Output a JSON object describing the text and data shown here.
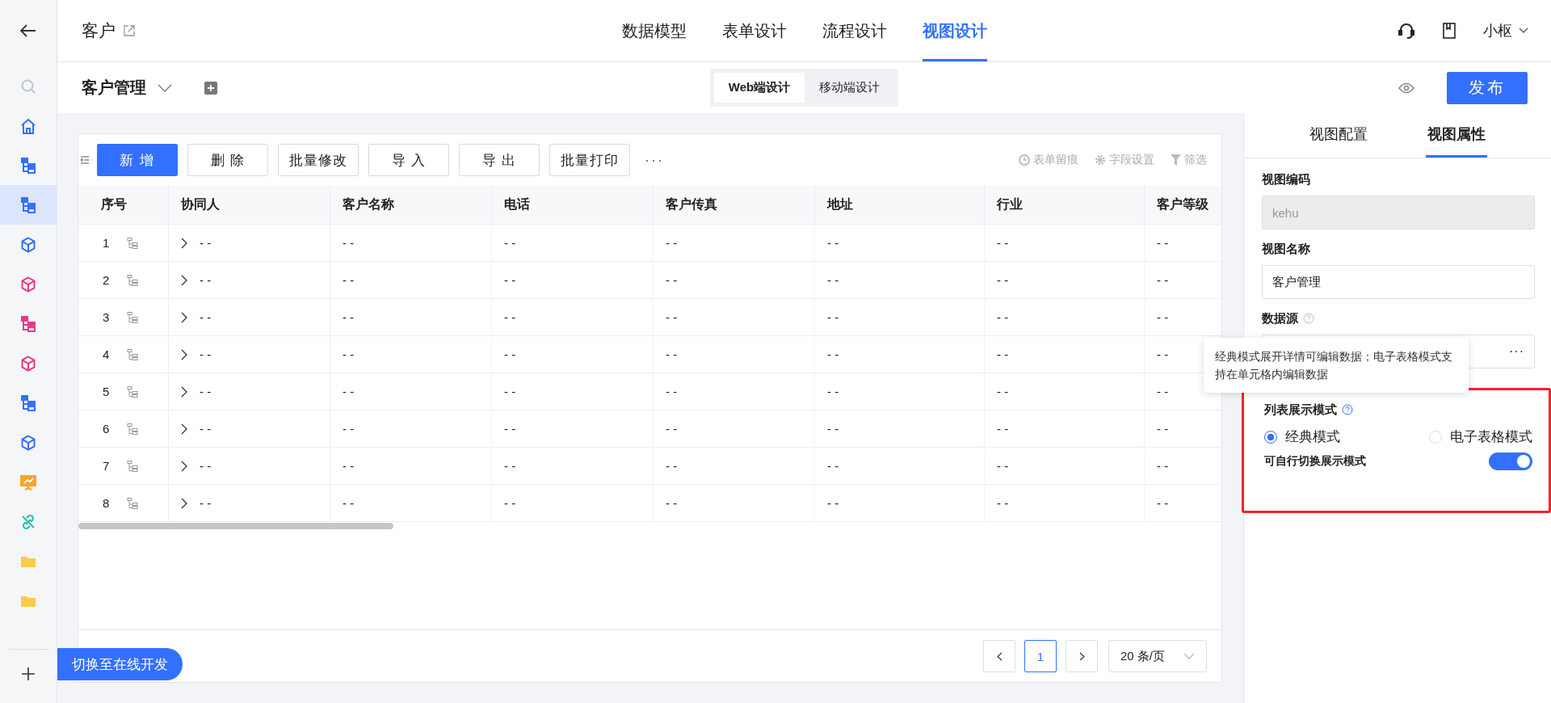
{
  "sidebar": {
    "items": [
      {
        "kind": "search",
        "color": "#c0c4cc",
        "selected": false
      },
      {
        "kind": "home",
        "color": "#3370ff",
        "selected": false
      },
      {
        "kind": "tree",
        "color": "#3370ff",
        "selected": false
      },
      {
        "kind": "tree",
        "color": "#3370ff",
        "selected": true
      },
      {
        "kind": "cube",
        "color": "#3370ff",
        "selected": false
      },
      {
        "kind": "cube",
        "color": "#e8388a",
        "selected": false
      },
      {
        "kind": "tree",
        "color": "#e8388a",
        "selected": false
      },
      {
        "kind": "cube",
        "color": "#e8388a",
        "selected": false
      },
      {
        "kind": "tree",
        "color": "#3370ff",
        "selected": false
      },
      {
        "kind": "cube",
        "color": "#3370ff",
        "selected": false
      },
      {
        "kind": "board",
        "color": "#f5a623",
        "selected": false
      },
      {
        "kind": "link",
        "color": "#2bbdb0",
        "selected": false
      },
      {
        "kind": "folder",
        "color": "#fdc94a",
        "selected": false
      },
      {
        "kind": "folder",
        "color": "#fdc94a",
        "selected": false
      }
    ]
  },
  "header": {
    "title": "客户",
    "nav": [
      {
        "label": "数据模型",
        "selected": false
      },
      {
        "label": "表单设计",
        "selected": false
      },
      {
        "label": "流程设计",
        "selected": false
      },
      {
        "label": "视图设计",
        "selected": true
      }
    ],
    "user": "小枢"
  },
  "subbar": {
    "view_name": "客户管理",
    "devices": [
      {
        "label": "Web端设计",
        "selected": true
      },
      {
        "label": "移动端设计",
        "selected": false
      }
    ],
    "publish": "发布"
  },
  "toolbar": {
    "buttons": [
      {
        "label": "新 增",
        "kind": "primary"
      },
      {
        "label": "删 除",
        "kind": "default"
      },
      {
        "label": "批量修改",
        "kind": "default"
      },
      {
        "label": "导 入",
        "kind": "default"
      },
      {
        "label": "导 出",
        "kind": "default"
      },
      {
        "label": "批量打印",
        "kind": "default"
      }
    ],
    "more": "···",
    "tools": [
      {
        "label": "表单留痕",
        "kind": "clock"
      },
      {
        "label": "字段设置",
        "kind": "gear"
      },
      {
        "label": "筛选",
        "kind": "filter"
      }
    ]
  },
  "table": {
    "columns": [
      "序号",
      "协同人",
      "客户名称",
      "电话",
      "客户传真",
      "地址",
      "行业",
      "客户等级"
    ],
    "rows": [
      {
        "cells": [
          "1",
          "- -",
          "- -",
          "- -",
          "- -",
          "- -",
          "- -",
          "- -"
        ]
      },
      {
        "cells": [
          "2",
          "- -",
          "- -",
          "- -",
          "- -",
          "- -",
          "- -",
          "- -"
        ]
      },
      {
        "cells": [
          "3",
          "- -",
          "- -",
          "- -",
          "- -",
          "- -",
          "- -",
          "- -"
        ]
      },
      {
        "cells": [
          "4",
          "- -",
          "- -",
          "- -",
          "- -",
          "- -",
          "- -",
          "- -"
        ]
      },
      {
        "cells": [
          "5",
          "- -",
          "- -",
          "- -",
          "- -",
          "- -",
          "- -",
          "- -"
        ]
      },
      {
        "cells": [
          "6",
          "- -",
          "- -",
          "- -",
          "- -",
          "- -",
          "- -",
          "- -"
        ]
      },
      {
        "cells": [
          "7",
          "- -",
          "- -",
          "- -",
          "- -",
          "- -",
          "- -",
          "- -"
        ]
      },
      {
        "cells": [
          "8",
          "- -",
          "- -",
          "- -",
          "- -",
          "- -",
          "- -",
          "- -"
        ]
      }
    ]
  },
  "pagination": {
    "pages": [
      {
        "label": "1",
        "selected": true
      }
    ],
    "page_size": "20 条/页"
  },
  "float_button": "切换至在线开发",
  "panel": {
    "tabs": [
      {
        "label": "视图配置",
        "selected": false
      },
      {
        "label": "视图属性",
        "selected": true
      }
    ],
    "fields": [
      {
        "label": "视图编码",
        "kind": "input",
        "value": "kehu",
        "disabled": true,
        "help": false
      },
      {
        "label": "视图名称",
        "kind": "input",
        "value": "客户管理",
        "disabled": false,
        "help": false
      },
      {
        "label": "数据源",
        "kind": "picker",
        "button": "···",
        "disabled": false,
        "help": true
      }
    ],
    "tooltip": "经典模式展开详情可编辑数据；电子表格模式支持在单元格内编辑数据",
    "display_mode": {
      "title": "列表展示模式",
      "help": true,
      "highlighted": true,
      "options": [
        {
          "label": "经典模式",
          "selected": true
        },
        {
          "label": "电子表格模式",
          "selected": false
        }
      ],
      "switch": {
        "label": "可自行切换展示模式",
        "on": true
      }
    }
  }
}
